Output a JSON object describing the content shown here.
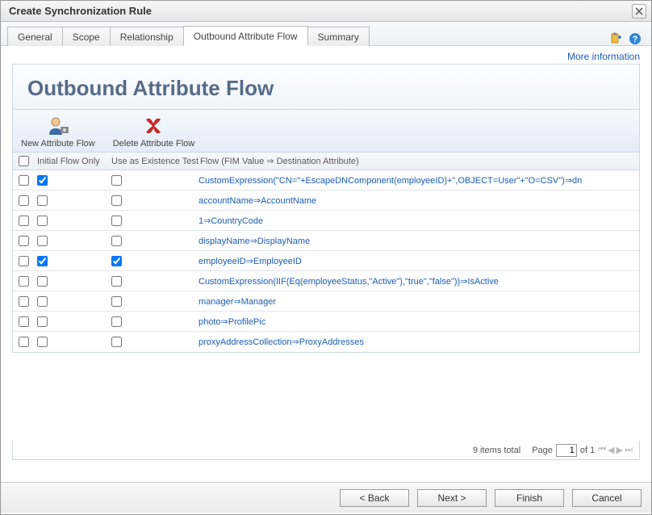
{
  "window": {
    "title": "Create Synchronization Rule"
  },
  "tabs": {
    "items": [
      "General",
      "Scope",
      "Relationship",
      "Outbound Attribute Flow",
      "Summary"
    ],
    "activeIndex": 3
  },
  "more_info": "More information",
  "page": {
    "heading": "Outbound Attribute Flow"
  },
  "toolbar": {
    "new_flow": "New Attribute Flow",
    "delete_flow": "Delete Attribute Flow"
  },
  "columns": {
    "initial_flow_only": "Initial Flow Only",
    "use_as_existence": "Use as Existence Test",
    "flow": "Flow (FIM Value ⇒ Destination Attribute)"
  },
  "rows": [
    {
      "selected": false,
      "initialFlowOnly": true,
      "useAsExistence": false,
      "flow": "CustomExpression(\"CN=\"+EscapeDNComponent(employeeID)+\",OBJECT=User\"+\"O=CSV\")⇒dn"
    },
    {
      "selected": false,
      "initialFlowOnly": false,
      "useAsExistence": false,
      "flow": "accountName⇒AccountName"
    },
    {
      "selected": false,
      "initialFlowOnly": false,
      "useAsExistence": false,
      "flow": "1⇒CountryCode"
    },
    {
      "selected": false,
      "initialFlowOnly": false,
      "useAsExistence": false,
      "flow": "displayName⇒DisplayName"
    },
    {
      "selected": false,
      "initialFlowOnly": true,
      "useAsExistence": true,
      "flow": "employeeID⇒EmployeeID"
    },
    {
      "selected": false,
      "initialFlowOnly": false,
      "useAsExistence": false,
      "flow": "CustomExpression(IIF(Eq(employeeStatus,\"Active\"),\"true\",\"false\"))⇒IsActive"
    },
    {
      "selected": false,
      "initialFlowOnly": false,
      "useAsExistence": false,
      "flow": "manager⇒Manager"
    },
    {
      "selected": false,
      "initialFlowOnly": false,
      "useAsExistence": false,
      "flow": "photo⇒ProfilePic"
    },
    {
      "selected": false,
      "initialFlowOnly": false,
      "useAsExistence": false,
      "flow": "proxyAddressCollection⇒ProxyAddresses"
    }
  ],
  "footer": {
    "total_text": "9 items total",
    "page_label": "Page",
    "page_value": "1",
    "page_of": "of 1"
  },
  "wizard": {
    "back": "< Back",
    "next": "Next >",
    "finish": "Finish",
    "cancel": "Cancel"
  }
}
